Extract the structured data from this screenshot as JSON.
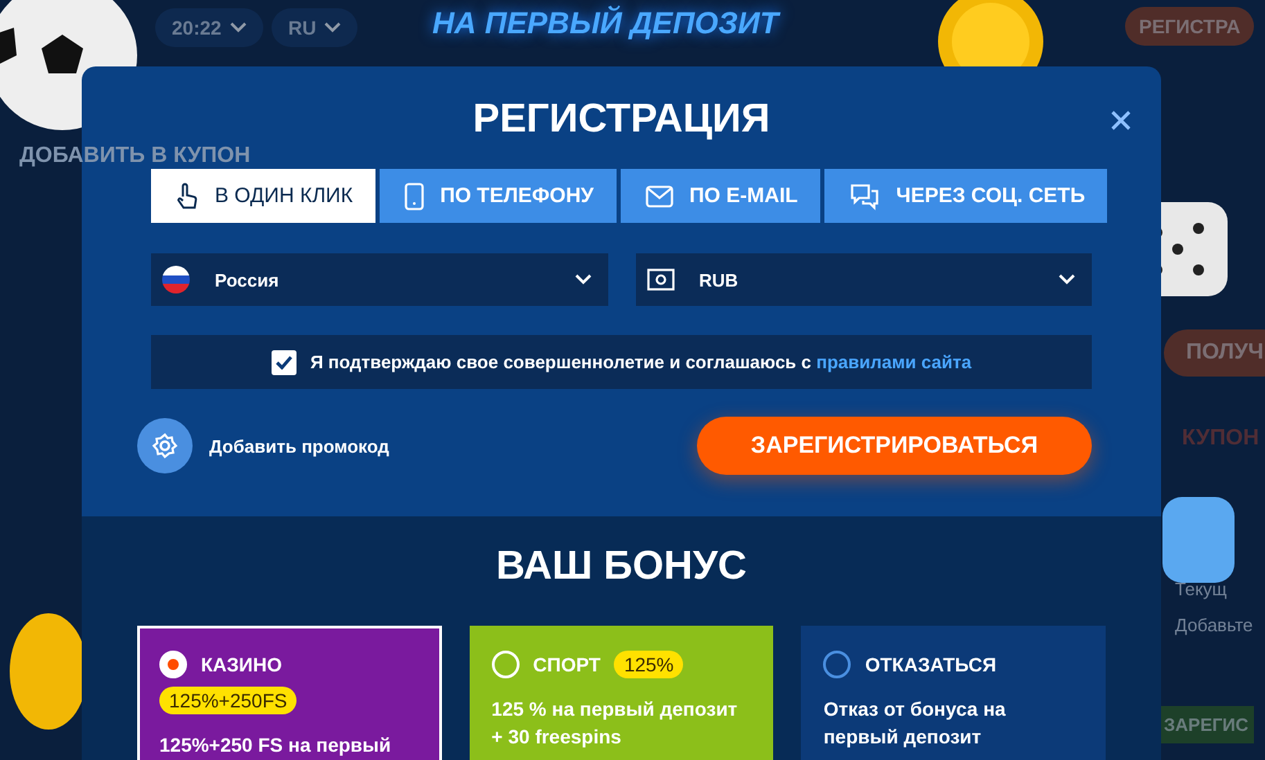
{
  "background": {
    "time": "20:22",
    "language": "RU",
    "banner": "НА ПЕРВЫЙ ДЕПОЗИТ",
    "register_button": "РЕГИСТРА",
    "coupon_button": "ДОБАВИТЬ В КУПОН",
    "get_button": "ПОЛУЧ",
    "coupon_label": "КУПОН",
    "side_texts": [
      "Текущ",
      "Добавьте"
    ],
    "bottom_button": "ЗАРЕГИС"
  },
  "modal": {
    "title": "РЕГИСТРАЦИЯ",
    "tabs": [
      {
        "label": "В ОДИН КЛИК",
        "kind": "click",
        "selected": true
      },
      {
        "label": "ПО ТЕЛЕФОНУ",
        "kind": "phone",
        "selected": false
      },
      {
        "label": "ПО E-MAIL",
        "kind": "email",
        "selected": false
      },
      {
        "label": "ЧЕРЕЗ СОЦ. СЕТЬ",
        "kind": "social",
        "selected": false
      }
    ],
    "country": {
      "value": "Россия"
    },
    "currency": {
      "value": "RUB"
    },
    "agreement": {
      "checked": true,
      "text": "Я подтверждаю свое совершеннолетие и соглашаюсь с",
      "link": "правилами сайта"
    },
    "promo": "Добавить промокод",
    "submit": "ЗАРЕГИСТРИРОВАТЬСЯ",
    "bonus_title": "ВАШ БОНУС",
    "bonuses": [
      {
        "kind": "casino",
        "title": "КАЗИНО",
        "badge": "125%+250FS",
        "description": "125%+250 FS на первый",
        "selected": true
      },
      {
        "kind": "sport",
        "title": "СПОРТ",
        "badge": "125%",
        "description": "125 % на первый депозит  + 30 freespins",
        "selected": false
      },
      {
        "kind": "none",
        "title": "ОТКАЗАТЬСЯ",
        "description": "Отказ от бонуса на первый депозит",
        "selected": false
      }
    ]
  }
}
